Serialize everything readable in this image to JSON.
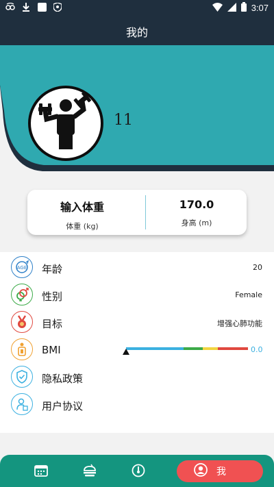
{
  "status_bar": {
    "time": "3:07",
    "left_icons": [
      "voicemail-icon",
      "download-icon",
      "square-icon",
      "shield-icon"
    ],
    "right_icons": [
      "wifi-icon",
      "signal-icon",
      "battery-icon"
    ]
  },
  "header": {
    "title": "我的"
  },
  "profile": {
    "username": "11",
    "avatar_icon": "weightlifter-icon",
    "colors": {
      "teal": "#2fa9b0",
      "dark": "#1f2f3e"
    }
  },
  "stats_card": {
    "weight_value": "输入体重",
    "weight_label": "体重 (kg)",
    "height_value": "170.0",
    "height_label": "身高 (m)"
  },
  "settings": {
    "age": {
      "label": "年龄",
      "value": "20",
      "icon": "age-icon"
    },
    "gender": {
      "label": "性别",
      "value": "Female",
      "icon": "gender-icon"
    },
    "goal": {
      "label": "目标",
      "value": "增强心肺功能",
      "icon": "medal-icon"
    },
    "bmi": {
      "label": "BMI",
      "value": "0.0",
      "icon": "bmi-icon",
      "scale_colors": [
        "#3bb0e0",
        "#3caa48",
        "#f2d541",
        "#e0483f"
      ],
      "level": 0
    },
    "privacy": {
      "label": "隐私政策",
      "icon": "shield-check-icon"
    },
    "agreement": {
      "label": "用户协议",
      "icon": "user-doc-icon"
    }
  },
  "bottom_nav": {
    "items": [
      "calendar-icon",
      "food-icon",
      "gauge-icon"
    ],
    "active_label": "我",
    "active_icon": "user-icon",
    "colors": {
      "bar": "#14957f",
      "active": "#f05152"
    }
  }
}
